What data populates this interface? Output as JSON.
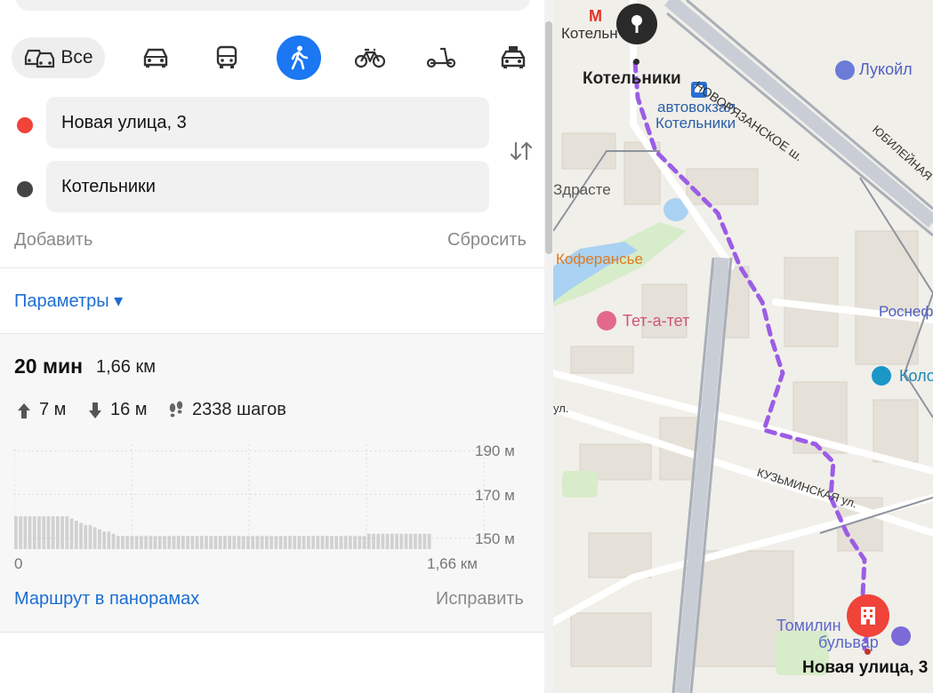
{
  "modes": {
    "all_label": "Все",
    "items": [
      "car-icon",
      "bus-icon",
      "walk-icon",
      "bike-icon",
      "scooter-icon",
      "taxi-icon"
    ],
    "selected": "walk",
    "accent": "#1b77f2"
  },
  "route": {
    "from": "Новая улица, 3",
    "to": "Котельники",
    "from_color": "#f0433a",
    "to_color": "#444444"
  },
  "actions": {
    "add": "Добавить",
    "reset": "Сбросить",
    "params": "Параметры ▾"
  },
  "summary": {
    "time": "20 мин",
    "distance": "1,66 км",
    "ascent": "7 м",
    "descent": "16 м",
    "steps": "2338 шагов"
  },
  "chart_data": {
    "type": "bar",
    "ytick_labels": [
      "190 м",
      "170 м",
      "150 м"
    ],
    "ylim": [
      145,
      193
    ],
    "xtick_labels": [
      "0",
      "1,66 км"
    ],
    "values": [
      160,
      160,
      160,
      160,
      160,
      160,
      160,
      160,
      160,
      160,
      160,
      160,
      159,
      158,
      157,
      156,
      156,
      155,
      154,
      153,
      153,
      152,
      151,
      151,
      151,
      151,
      151,
      151,
      151,
      151,
      151,
      151,
      151,
      151,
      151,
      151,
      151,
      151,
      151,
      151,
      151,
      151,
      151,
      151,
      151,
      151,
      151,
      151,
      151,
      151,
      151,
      151,
      151,
      151,
      151,
      151,
      151,
      151,
      151,
      151,
      151,
      151,
      151,
      151,
      151,
      151,
      151,
      151,
      151,
      151,
      151,
      151,
      151,
      151,
      151,
      151,
      152,
      152,
      152,
      152,
      152,
      152,
      152,
      152,
      152,
      152,
      152,
      152,
      152,
      152
    ]
  },
  "footer": {
    "panorama": "Маршрут в панорамах",
    "fix": "Исправить"
  },
  "map": {
    "labels": {
      "metro": "Котельн",
      "kotelniki": "Котельники",
      "bus_station_1": "автовокзал",
      "bus_station_2": "Котельники",
      "highway": "НОВОРЯЗАНСКОЕ ш.",
      "jubilee": "ЮБИЛЕЙНАЯ",
      "lukoil": "Лукойл",
      "zdraste": "Здрасте",
      "coffee": "Коферансье",
      "tet": "Тет-а-тет",
      "rosneft": "Роснеф",
      "kolo": "Коло",
      "ul": "ул.",
      "kuzminskaya": "КУЗЬМИНСКАЯ ул.",
      "tomilino_1": "Томилин",
      "tomilino_2": "бульвар",
      "dest": "Новая улица, 3"
    },
    "route_color": "#9b5de5"
  }
}
